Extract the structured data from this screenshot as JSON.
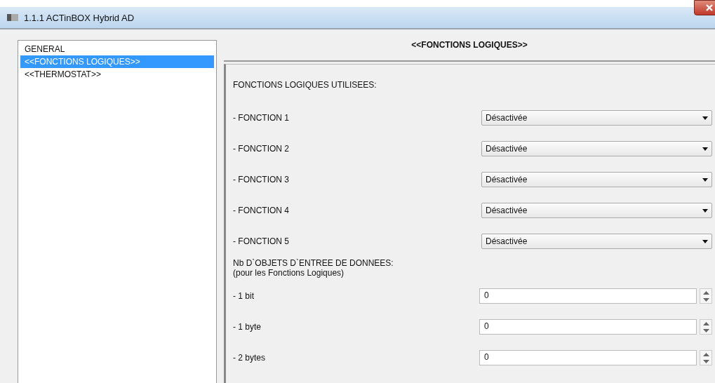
{
  "window": {
    "title": "1.1.1 ACTinBOX Hybrid AD"
  },
  "sidebar": {
    "items": [
      {
        "label": "GENERAL",
        "selected": false
      },
      {
        "label": "<<FONCTIONS LOGIQUES>>",
        "selected": true
      },
      {
        "label": "<<THERMOSTAT>>",
        "selected": false
      }
    ]
  },
  "panel": {
    "title": "<<FONCTIONS LOGIQUES>>",
    "section_label": "FONCTIONS LOGIQUES UTILISEES:",
    "functions": [
      {
        "label": "- FONCTION 1",
        "value": "Désactivée"
      },
      {
        "label": "- FONCTION 2",
        "value": "Désactivée"
      },
      {
        "label": "- FONCTION 3",
        "value": "Désactivée"
      },
      {
        "label": "- FONCTION 4",
        "value": "Désactivée"
      },
      {
        "label": "- FONCTION 5",
        "value": "Désactivée"
      }
    ],
    "objects_label": "Nb D`OBJETS D`ENTREE DE DONNEES:",
    "objects_note": "(pour les Fonctions Logiques)",
    "objects": [
      {
        "label": "- 1 bit",
        "value": "0"
      },
      {
        "label": "- 1 byte",
        "value": "0"
      },
      {
        "label": "- 2 bytes",
        "value": "0"
      }
    ]
  }
}
